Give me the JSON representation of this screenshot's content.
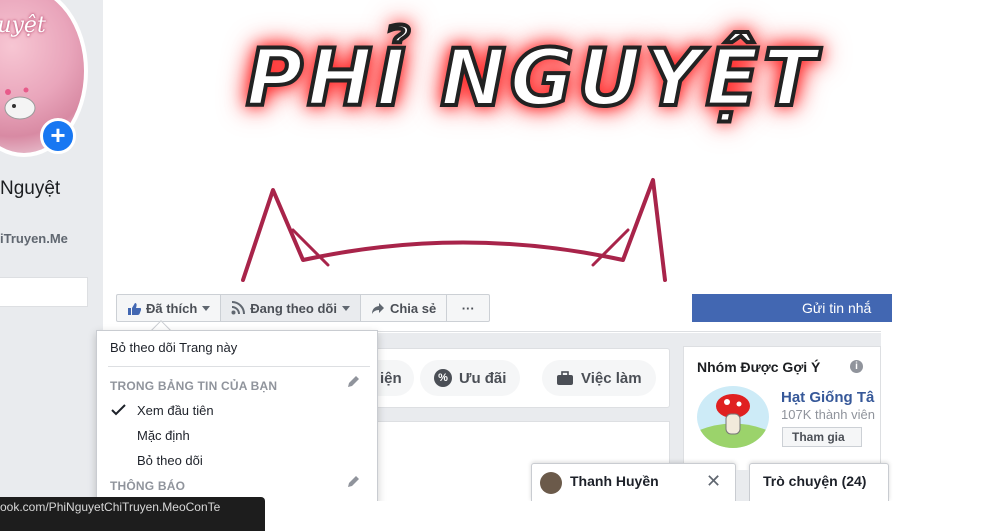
{
  "sidebar": {
    "avatar_text": "Nguyệt",
    "page_name": "Nguyệt",
    "page_handle": "iTruyen.Me"
  },
  "cover": {
    "title": "PHỈ NGUYỆT"
  },
  "actions": {
    "liked": "Đã thích",
    "following": "Đang theo dõi",
    "share": "Chia sẻ",
    "more": "···",
    "send_message": "Gửi tin nhắ"
  },
  "dropdown": {
    "unfollow_page": "Bỏ theo dõi Trang này",
    "section_feed": "TRONG BẢNG TIN CỦA BẠN",
    "see_first": "Xem đầu tiên",
    "default": "Mặc định",
    "unfollow": "Bỏ theo dõi",
    "section_notifications": "THÔNG BÁO"
  },
  "tabs": {
    "partial": "iện",
    "offers": "Ưu đãi",
    "jobs": "Việc làm"
  },
  "suggested_groups": {
    "title": "Nhóm Được Gợi Ý",
    "group_name": "Hạt Giống Tâ",
    "members": "107K thành viên",
    "join": "Tham gia"
  },
  "chat": {
    "contact_name": "Thanh Huyền",
    "chat_label": "Trò chuyện (24)"
  },
  "status_bar": {
    "url": "ook.com/PhiNguyetChiTruyen.MeoConTe"
  },
  "colors": {
    "accent": "#4267b2",
    "link": "#365899",
    "cover_glow": "#ff2a2a"
  }
}
